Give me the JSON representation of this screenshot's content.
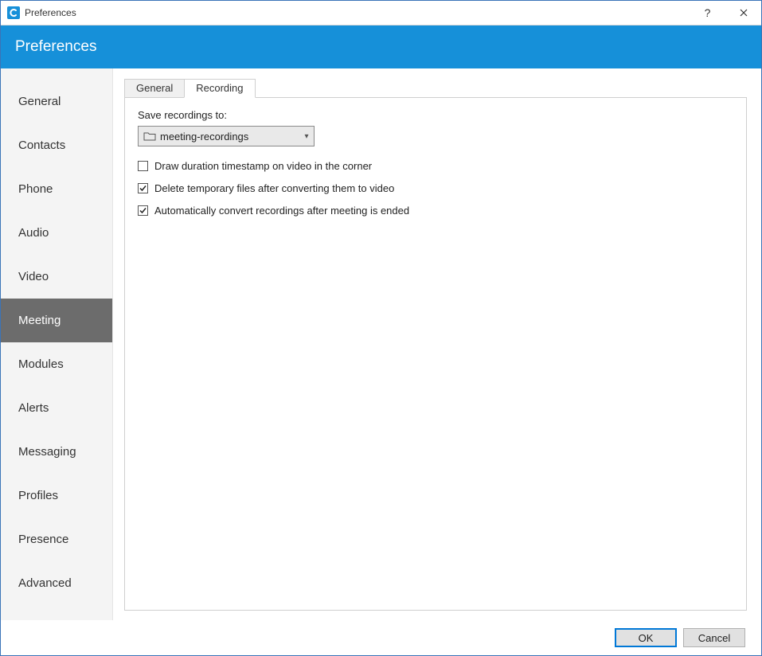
{
  "window": {
    "title": "Preferences"
  },
  "header": {
    "title": "Preferences"
  },
  "sidebar": {
    "items": [
      {
        "label": "General"
      },
      {
        "label": "Contacts"
      },
      {
        "label": "Phone"
      },
      {
        "label": "Audio"
      },
      {
        "label": "Video"
      },
      {
        "label": "Meeting"
      },
      {
        "label": "Modules"
      },
      {
        "label": "Alerts"
      },
      {
        "label": "Messaging"
      },
      {
        "label": "Profiles"
      },
      {
        "label": "Presence"
      },
      {
        "label": "Advanced"
      }
    ],
    "active_index": 5
  },
  "tabs": {
    "items": [
      {
        "label": "General"
      },
      {
        "label": "Recording"
      }
    ],
    "active_index": 1
  },
  "recording": {
    "save_label": "Save recordings to:",
    "folder_name": "meeting-recordings",
    "options": [
      {
        "label": "Draw duration timestamp on video in the corner",
        "checked": false
      },
      {
        "label": "Delete temporary files after converting them to video",
        "checked": true
      },
      {
        "label": "Automatically convert recordings after meeting is ended",
        "checked": true
      }
    ]
  },
  "footer": {
    "ok_label": "OK",
    "cancel_label": "Cancel"
  }
}
